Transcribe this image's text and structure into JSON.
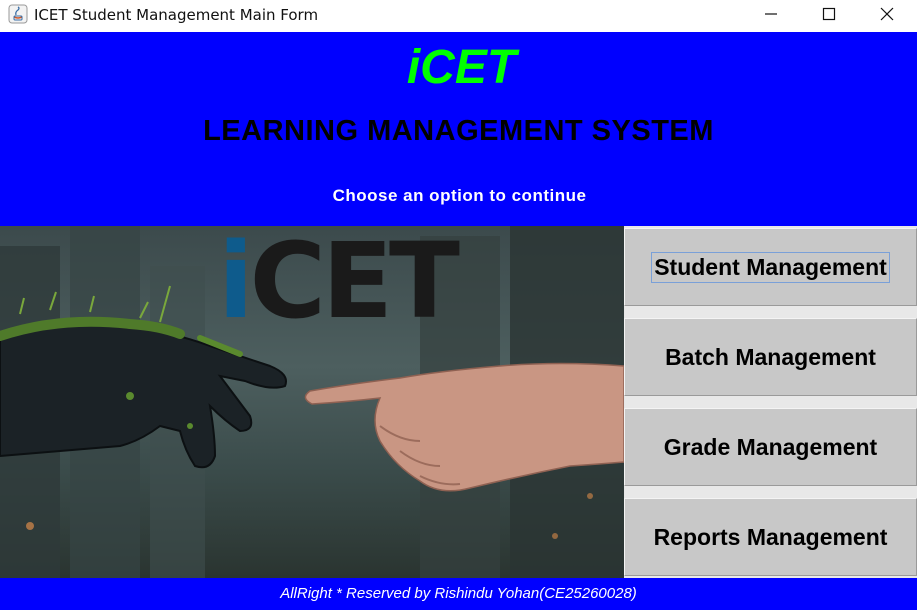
{
  "window": {
    "title": "ICET Student Management Main Form",
    "controls": [
      "minimize",
      "maximize",
      "close"
    ]
  },
  "header": {
    "brand": "iCET",
    "system_title": "LEARNING MANAGEMENT SYSTEM",
    "subtitle": "Choose an option to continue",
    "background_color": "#0000ff",
    "brand_color": "#00ff00"
  },
  "hero": {
    "logo_text_i": "i",
    "logo_text_rest": "CET",
    "description_icons": [
      "robot-hand",
      "human-hand"
    ]
  },
  "menu": {
    "items": [
      {
        "label": "Student Management"
      },
      {
        "label": "Batch Management"
      },
      {
        "label": "Grade Management"
      },
      {
        "label": "Reports Management"
      }
    ]
  },
  "footer": {
    "text": "AllRight * Reserved by Rishindu Yohan(CE25260028)"
  }
}
